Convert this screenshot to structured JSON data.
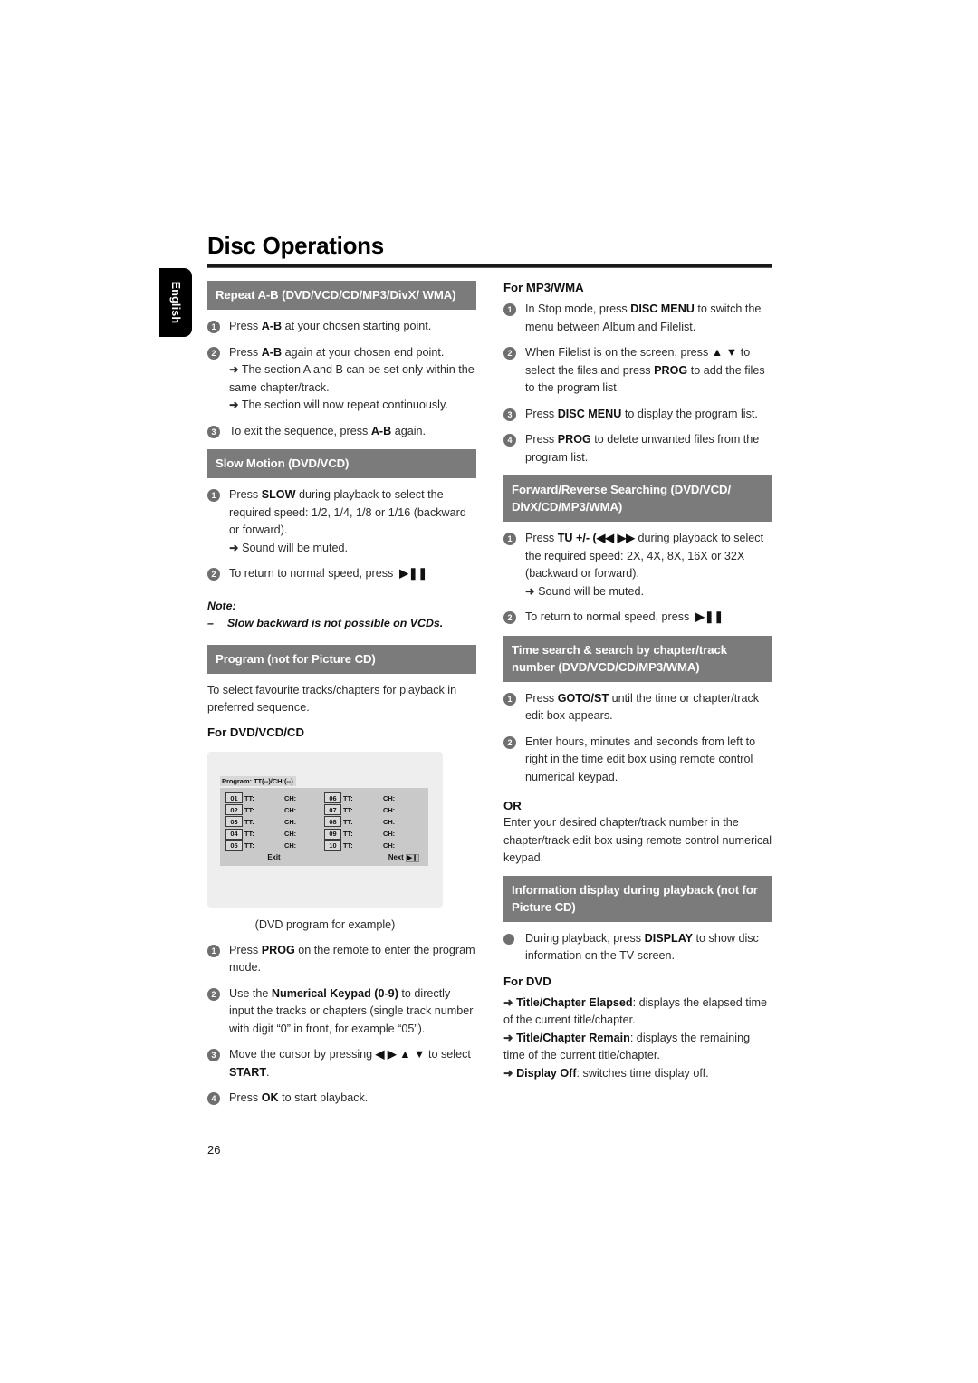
{
  "language_tab": "English",
  "page_title": "Disc Operations",
  "page_number": "26",
  "left_column": {
    "repeat_ab": {
      "heading": "Repeat A-B (DVD/VCD/CD/MP3/DivX/ WMA)",
      "steps": [
        {
          "num": "1",
          "text": "Press ",
          "bold": "A-B",
          "rest": " at your chosen starting point."
        },
        {
          "num": "2",
          "text": "Press ",
          "bold": "A-B",
          "rest": " again at your chosen end point."
        },
        {
          "num": "3",
          "text": "To exit the sequence, press ",
          "bold": "A-B",
          "rest": " again."
        }
      ],
      "step2_arrow1": "The section A and B can be set only within the same chapter/track.",
      "step2_arrow2": "The section will now repeat continuously."
    },
    "slow_motion": {
      "heading": "Slow Motion (DVD/VCD)",
      "step1_pre": "Press ",
      "step1_bold": "SLOW",
      "step1_rest": " during playback to select the required speed: 1/2, 1/4, 1/8 or 1/16 (backward or forward).",
      "step1_arrow": "Sound will be muted.",
      "step2_text": "To return to normal speed, press",
      "step2_icon": "play-pause-glyph"
    },
    "note": {
      "title": "Note:",
      "dash": "–",
      "item": "Slow backward is not possible on VCDs."
    },
    "program": {
      "heading": "Program (not for Picture CD)",
      "intro": "To select favourite tracks/chapters for playback in preferred sequence.",
      "sub_head": "For DVD/VCD/CD",
      "osd": {
        "title": "Program: TT(--)/CH:(--)",
        "col_left": [
          {
            "index": "01",
            "tt": "TT:",
            "ch": "CH:"
          },
          {
            "index": "02",
            "tt": "TT:",
            "ch": "CH:"
          },
          {
            "index": "03",
            "tt": "TT:",
            "ch": "CH:"
          },
          {
            "index": "04",
            "tt": "TT:",
            "ch": "CH:"
          },
          {
            "index": "05",
            "tt": "TT:",
            "ch": "CH:"
          }
        ],
        "col_right": [
          {
            "index": "06",
            "tt": "TT:",
            "ch": "CH:"
          },
          {
            "index": "07",
            "tt": "TT:",
            "ch": "CH:"
          },
          {
            "index": "08",
            "tt": "TT:",
            "ch": "CH:"
          },
          {
            "index": "09",
            "tt": "TT:",
            "ch": "CH:"
          },
          {
            "index": "10",
            "tt": "TT:",
            "ch": "CH:"
          }
        ],
        "exit_label": "Exit",
        "next_label": "Next",
        "next_icon": "skip-next-glyph"
      },
      "caption": "(DVD program for example)",
      "steps": [
        {
          "num": "1",
          "pre": "Press ",
          "bold": "PROG",
          "rest": " on the remote to enter the program mode."
        },
        {
          "num": "2",
          "pre": "Use the ",
          "bold": "Numerical Keypad (0-9)",
          "rest": " to directly input the tracks or chapters (single track number with digit “0” in front, for example “05”)."
        },
        {
          "num": "3",
          "pre": "Move the cursor by pressing ",
          "arrows": "◀ ▶ ▲ ▼",
          "mid": " to select ",
          "bold": "START",
          "rest": "."
        },
        {
          "num": "4",
          "pre": "Press ",
          "bold": "OK",
          "rest": " to start playback."
        }
      ]
    }
  },
  "right_column": {
    "mp3_wma": {
      "sub_head": "For MP3/WMA",
      "steps": [
        {
          "num": "1",
          "pre": "In Stop mode, press ",
          "bold": "DISC MENU",
          "rest": " to switch the menu between Album and Filelist."
        },
        {
          "num": "2",
          "pre": "When Filelist is on the screen, press ",
          "arrows": "▲ ▼",
          "mid": " to select the files and press ",
          "bold": "PROG",
          "rest": " to add the files to the program list."
        },
        {
          "num": "3",
          "pre": "Press ",
          "bold": "DISC MENU",
          "rest": " to display the program list."
        },
        {
          "num": "4",
          "pre": "Press ",
          "bold": "PROG",
          "rest": " to delete unwanted files from the program list."
        }
      ]
    },
    "fwd_rev_search": {
      "heading": "Forward/Reverse Searching (DVD/VCD/ DivX/CD/MP3/WMA)",
      "step1_pre": "Press ",
      "step1_bold": "TU +/-",
      "step1_icons": "(◀◀   ▶▶",
      "step1_rest": " during playback to select the required speed: 2X, 4X, 8X, 16X or 32X (backward or forward).",
      "step1_arrow": "Sound will be muted.",
      "step2_text": "To return to normal speed, press",
      "step2_icon": "play-pause-glyph"
    },
    "time_search": {
      "heading": "Time search & search by chapter/track number (DVD/VCD/CD/MP3/WMA)",
      "steps": [
        {
          "num": "1",
          "pre": "Press ",
          "bold": "GOTO/ST",
          "rest": " until the time or chapter/track edit box appears."
        },
        {
          "num": "2",
          "pre": "",
          "bold": "",
          "rest": "Enter hours, minutes and seconds from left to right in the time edit box using remote control numerical keypad."
        }
      ],
      "or_label": "OR",
      "or_text": "Enter your desired chapter/track number in the chapter/track edit box using remote control numerical keypad."
    },
    "info_display": {
      "heading": "Information display during playback (not for Picture CD)",
      "bullet": "During playback, press ",
      "bullet_bold": "DISPLAY",
      "bullet_rest": " to show disc information on the TV screen.",
      "sub_head": "For DVD",
      "defs": [
        {
          "term": "Title/Chapter Elapsed",
          "desc": ": displays the elapsed time of the current title/chapter."
        },
        {
          "term": "Title/Chapter Remain",
          "desc": ": displays the remaining time of the current title/chapter."
        },
        {
          "term": "Display Off",
          "desc": ": switches time display off."
        }
      ]
    }
  },
  "colors": {
    "section_header_bg": "#7b7b7b",
    "section_header_text": "#ffffff",
    "bullet_bg": "#6f6f6f",
    "osd_panel_bg": "#c9c9c9",
    "figure_bg": "#eeeeee",
    "text": "#2b2b2b"
  }
}
